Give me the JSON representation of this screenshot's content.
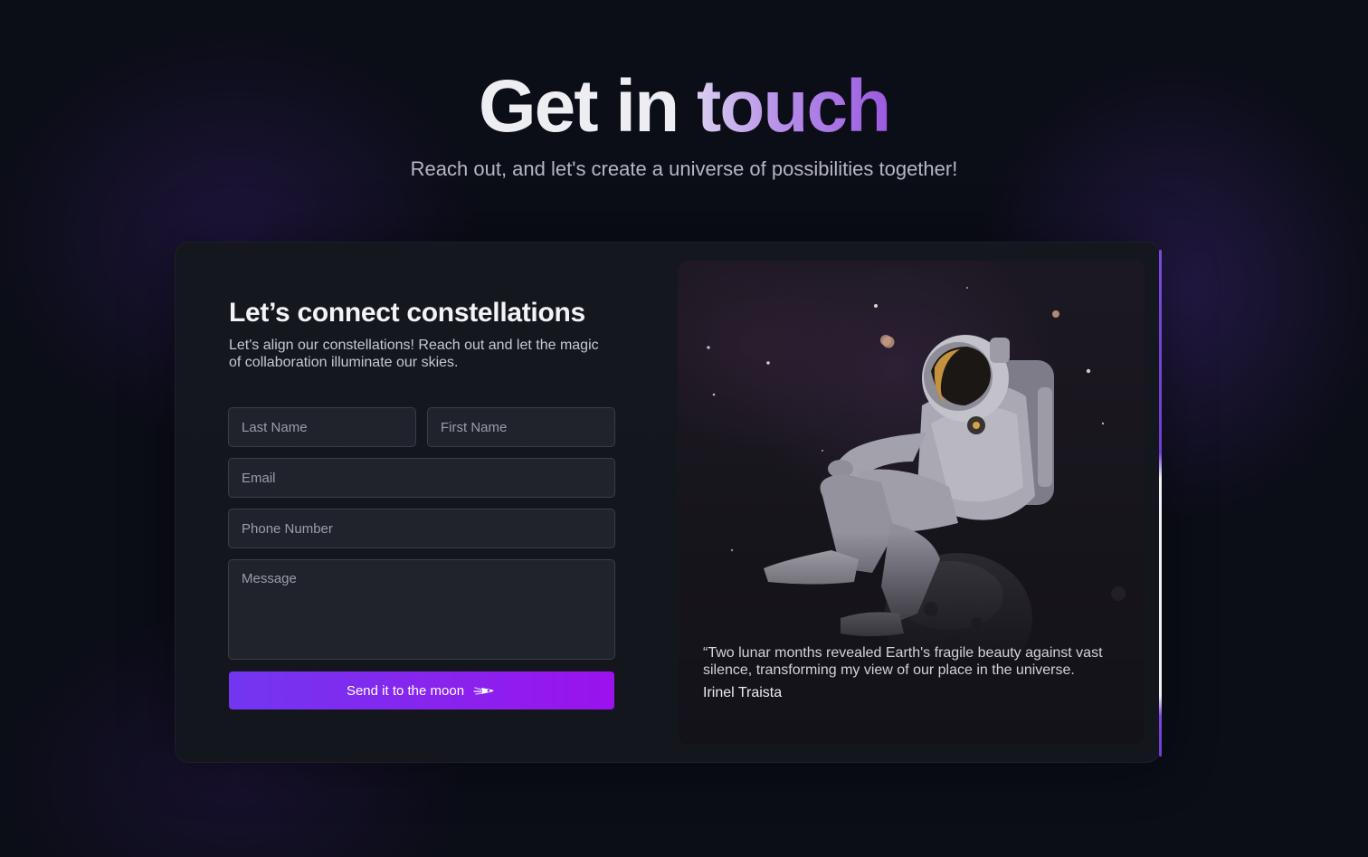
{
  "hero": {
    "title_part1": "Get in",
    "title_part2": "touch",
    "subtitle": "Reach out, and let's create a universe of possibilities together!"
  },
  "form": {
    "title": "Let’s connect constellations",
    "description": "Let's align our constellations! Reach out and let the magic of collaboration illuminate our skies.",
    "last_name_placeholder": "Last Name",
    "first_name_placeholder": "First Name",
    "email_placeholder": "Email",
    "phone_placeholder": "Phone Number",
    "message_placeholder": "Message",
    "submit_label": "Send it to the moon",
    "submit_icon": "rocket-icon"
  },
  "testimonial": {
    "quote": "“Two lunar months revealed Earth's fragile beauty against vast silence, transforming my view of our place in the universe.",
    "author": "Irinel Traista",
    "image_subject": "astronaut-sitting-on-moon"
  },
  "colors": {
    "background": "#0b0d17",
    "card": "#15171f",
    "accent_start": "#7336f0",
    "accent_end": "#9b12ec",
    "title_gradient_end": "#9b5ae0"
  }
}
